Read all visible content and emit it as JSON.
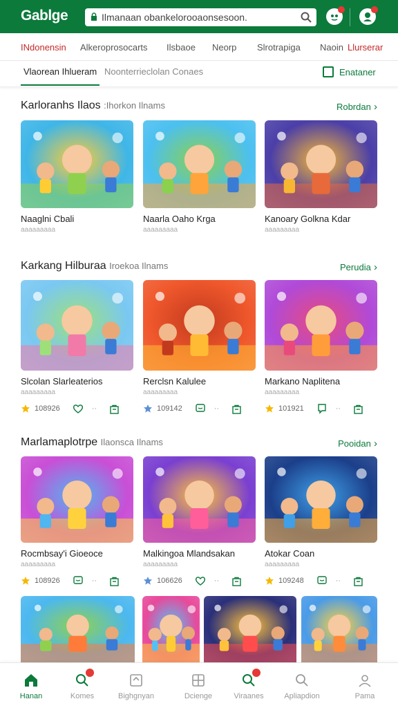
{
  "app": {
    "title": "Gablge"
  },
  "search": {
    "value": "Ilmanaan obankelorooaonsesoon."
  },
  "categories": [
    {
      "label": "INdonensin",
      "red": true
    },
    {
      "label": "Alkeroprosocarts",
      "red": false
    },
    {
      "label": "Ilsbaoe",
      "red": false
    },
    {
      "label": "Neorp",
      "red": false
    },
    {
      "label": "Slrotrapiga",
      "red": false
    },
    {
      "label": "Naoin",
      "red": false
    },
    {
      "label": "Llurserar",
      "red": true
    }
  ],
  "subtabs": {
    "active": "Vlaorean Ihlueram",
    "inactive": "Noonterrieclolan Conaes",
    "right": "Enataner"
  },
  "sections": [
    {
      "title": "Karloranhs Ilaos",
      "subtitle": ":Ihorkon Ilnams",
      "link": "Robrdan",
      "cards": [
        {
          "name": "Naaglni Cbali",
          "sub": "aaaaaaaaa",
          "colors": [
            "#3fb6e8",
            "#8fd14f",
            "#ffcc33"
          ]
        },
        {
          "name": "Naarla Oaho Krga",
          "sub": "aaaaaaaaa",
          "colors": [
            "#4cc0f0",
            "#ffa43a",
            "#8ad14e"
          ]
        },
        {
          "name": "Kanoary Golkna Kdar",
          "sub": "aaaaaaaaa",
          "colors": [
            "#4b3fa8",
            "#e86a3a",
            "#f7b733"
          ]
        }
      ]
    },
    {
      "title": "Karkang Hilburaa",
      "subtitle": "Iroekoa Ilnams",
      "link": "Perudia",
      "cards": [
        {
          "name": "Slcolan Slarleaterios",
          "sub": "aaaaaaaaa",
          "colors": [
            "#7ac8f2",
            "#f27aa8",
            "#9de07a"
          ],
          "rating": "108926"
        },
        {
          "name": "Rerclsn Kalulee",
          "sub": "aaaaaaaaa",
          "colors": [
            "#f0582c",
            "#ffbb33",
            "#c23a1e"
          ],
          "rating": "109142"
        },
        {
          "name": "Markano Naplitena",
          "sub": "aaaaaaaaa",
          "colors": [
            "#b04ad8",
            "#ff9d3a",
            "#e94a7c"
          ],
          "rating": "101921"
        }
      ]
    },
    {
      "title": "Marlamaplotrpe",
      "subtitle": "Ilaonsca Ilnams",
      "link": "Pooidan",
      "cards": [
        {
          "name": "Rocmbsay'i Gioeoce",
          "sub": "aaaaaaaaa",
          "colors": [
            "#c94fd6",
            "#ffd23d",
            "#4fb6f0"
          ],
          "rating": "108926"
        },
        {
          "name": "Malkingoa Mlandsakan",
          "sub": "aaaaaaaaa",
          "colors": [
            "#7a3fd1",
            "#ff5e9a",
            "#ffc23a"
          ],
          "rating": "106626"
        },
        {
          "name": "Atokar Coan",
          "sub": "aaaaaaaaa",
          "colors": [
            "#1c3f8a",
            "#ffae3a",
            "#3fa0e8"
          ],
          "rating": "109248"
        }
      ]
    }
  ],
  "bottom_row": [
    {
      "colors": [
        "#4cb8ef",
        "#ff7b3a",
        "#8fd14f"
      ]
    },
    {
      "colors": [
        "#e84a9b",
        "#ffcc33",
        "#4fc3f7"
      ]
    },
    {
      "colors": [
        "#2a2f7a",
        "#ff4d4d",
        "#ffc23a"
      ]
    },
    {
      "colors": [
        "#4a9be8",
        "#ff8c3a",
        "#ffd23d"
      ]
    }
  ],
  "bottom_nav": [
    {
      "label": "Hanan",
      "icon": "home-icon",
      "active": true,
      "badge": false
    },
    {
      "label": "Komes",
      "icon": "search-badge-icon",
      "active": false,
      "badge": true
    },
    {
      "label": "Bighgnyan",
      "icon": "gift-icon",
      "active": false,
      "badge": false
    },
    {
      "label": "Dcienge",
      "icon": "grid-icon",
      "active": false,
      "badge": false
    },
    {
      "label": "Viraanes",
      "icon": "search-badge-icon",
      "active": false,
      "badge": true
    },
    {
      "label": "Apliapdion",
      "icon": "search-icon",
      "active": false,
      "badge": false
    },
    {
      "label": "Pama",
      "icon": "user-icon",
      "active": false,
      "badge": false
    }
  ],
  "colors": {
    "brand": "#0b7a3b",
    "badge": "#e53935",
    "star": "#f5b800",
    "star_blue": "#5b8fd6"
  }
}
